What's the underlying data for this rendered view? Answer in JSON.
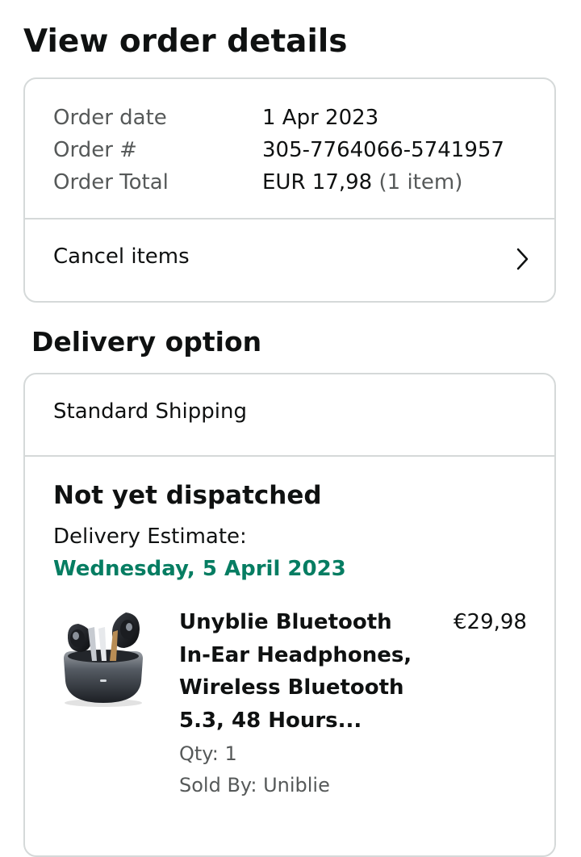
{
  "page": {
    "title": "View order details"
  },
  "order_summary": {
    "rows": [
      {
        "label": "Order date",
        "value": "1 Apr 2023"
      },
      {
        "label": "Order #",
        "value": "305-7764066-5741957"
      },
      {
        "label": "Order Total",
        "value": "EUR 17,98",
        "note": "(1 item)"
      }
    ],
    "cancel_label": "Cancel items",
    "cancel_icon": "chevron-right-icon"
  },
  "delivery": {
    "section_title": "Delivery option",
    "shipping_method": "Standard Shipping",
    "status": "Not yet dispatched",
    "estimate_label": "Delivery Estimate:",
    "estimate_date": "Wednesday, 5 April 2023",
    "estimate_color": "#067d62",
    "item": {
      "image_icon": "wireless-earbuds-image",
      "title_lines": [
        "Unyblie Bluetooth",
        "In-Ear Headphones,",
        "Wireless Bluetooth",
        "5.3, 48 Hours..."
      ],
      "price": "€29,98",
      "quantity": "Qty: 1",
      "sold_by": "Sold By: Uniblie"
    }
  },
  "colors": {
    "text_primary": "#0f1111",
    "text_secondary": "#565959",
    "border": "#d5d9d9"
  }
}
